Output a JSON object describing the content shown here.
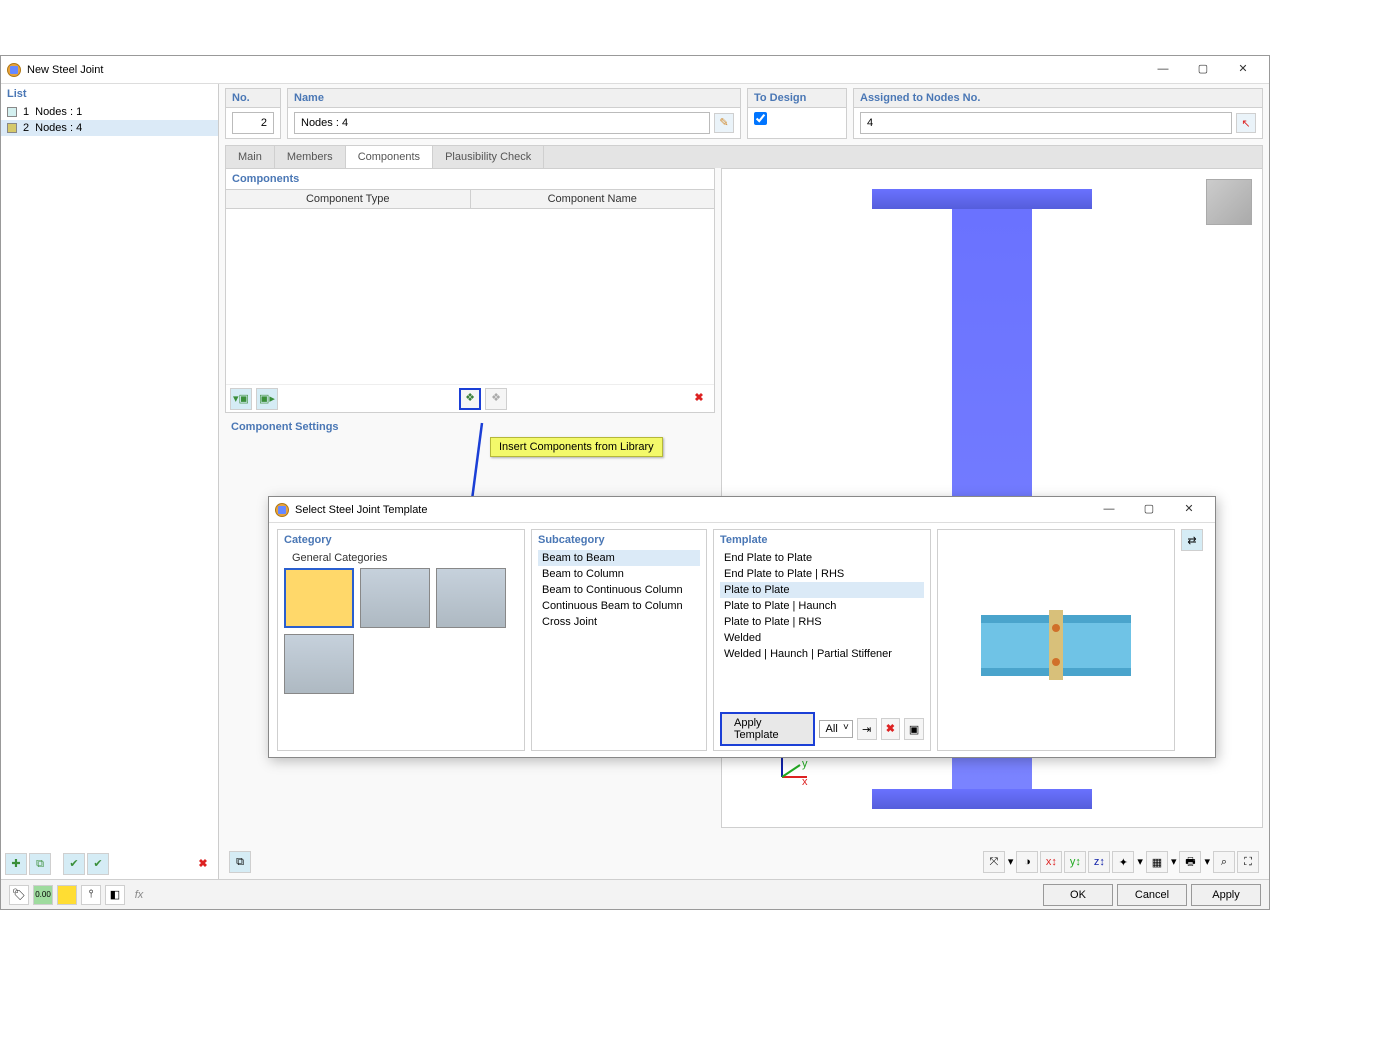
{
  "window": {
    "title": "New Steel Joint",
    "sidebar": {
      "header": "List",
      "items": [
        {
          "id": "1",
          "label": "Nodes : 1"
        },
        {
          "id": "2",
          "label": "Nodes : 4"
        }
      ]
    },
    "header_fields": {
      "no_label": "No.",
      "no_value": "2",
      "name_label": "Name",
      "name_value": "Nodes : 4",
      "to_design_label": "To Design",
      "to_design_checked": true,
      "assigned_label": "Assigned to Nodes No.",
      "assigned_value": "4"
    },
    "tabs": [
      "Main",
      "Members",
      "Components",
      "Plausibility Check"
    ],
    "active_tab": "Components",
    "components_panel": {
      "title": "Components",
      "col_type": "Component Type",
      "col_name": "Component Name"
    },
    "settings_title": "Component Settings",
    "tooltip": "Insert Components from Library",
    "footer": {
      "ok": "OK",
      "cancel": "Cancel",
      "apply": "Apply"
    }
  },
  "subdialog": {
    "title": "Select Steel Joint Template",
    "category": {
      "header": "Category",
      "subheader": "General Categories"
    },
    "subcategory": {
      "header": "Subcategory",
      "items": [
        "Beam to Beam",
        "Beam to Column",
        "Beam to Continuous Column",
        "Continuous Beam to Column",
        "Cross Joint"
      ],
      "selected": "Beam to Beam"
    },
    "template": {
      "header": "Template",
      "items": [
        "End Plate to Plate",
        "End Plate to Plate | RHS",
        "Plate to Plate",
        "Plate to Plate | Haunch",
        "Plate to Plate | RHS",
        "Welded",
        "Welded | Haunch | Partial Stiffener"
      ],
      "selected": "Plate to Plate",
      "apply_label": "Apply Template",
      "filter": "All"
    }
  }
}
